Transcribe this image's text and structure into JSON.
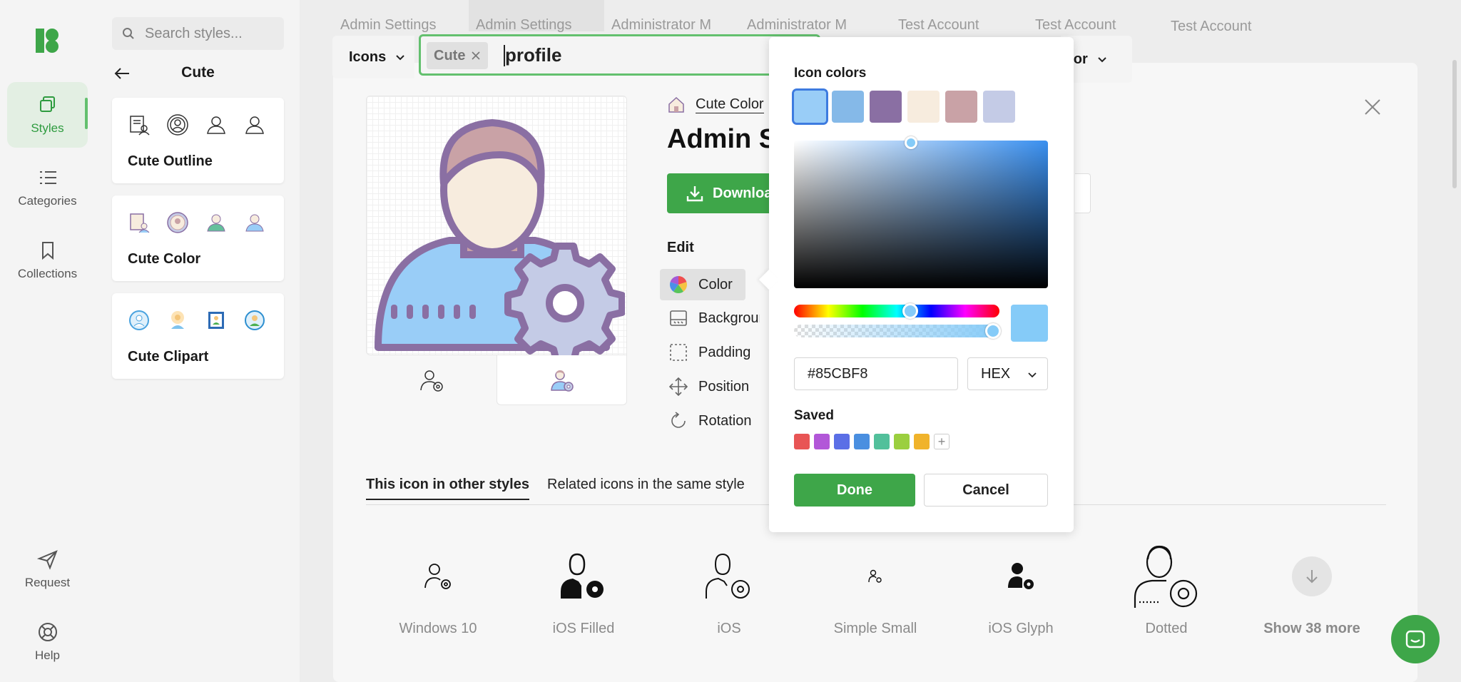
{
  "rail": {
    "items": [
      {
        "label": "Styles",
        "icon": "styles-icon"
      },
      {
        "label": "Categories",
        "icon": "list-icon"
      },
      {
        "label": "Collections",
        "icon": "bookmark-icon"
      },
      {
        "label": "Request",
        "icon": "send-icon"
      },
      {
        "label": "Help",
        "icon": "lifebuoy-icon"
      }
    ]
  },
  "styles_panel": {
    "search_placeholder": "Search styles...",
    "title": "Cute",
    "cards": [
      {
        "name": "Cute Outline"
      },
      {
        "name": "Cute Color"
      },
      {
        "name": "Cute Clipart"
      }
    ]
  },
  "top_tabs": [
    "Admin Settings",
    "Admin Settings",
    "Administrator M",
    "Administrator M",
    "Test Account",
    "Test Account",
    "Test Account"
  ],
  "toolbar": {
    "type_dropdown": "Icons",
    "chip": "Cute",
    "query": "profile",
    "color_dropdown": "olor"
  },
  "detail": {
    "style_name": "Cute Color",
    "title": "Admin Settings Male",
    "download_label": "Download",
    "edit_label": "Edit",
    "edit_items": [
      "Color",
      "Background",
      "Padding",
      "Position",
      "Rotation"
    ],
    "subtabs": [
      "This icon in other styles",
      "Related icons in the same style"
    ],
    "other_styles": [
      "Windows 10",
      "iOS Filled",
      "iOS",
      "Simple Small",
      "iOS Glyph",
      "Dotted",
      "Show 38 more"
    ]
  },
  "color_popover": {
    "title": "Icon colors",
    "swatches": [
      "#99cdf7",
      "#85b9e8",
      "#8a6fa3",
      "#f7ecde",
      "#c9a2a6",
      "#c4cbe6"
    ],
    "hex_value": "#85CBF8",
    "format": "HEX",
    "saved_label": "Saved",
    "saved": [
      "#e85555",
      "#b257d8",
      "#5b6fe6",
      "#4a8fe0",
      "#52c09b",
      "#9bcf3f",
      "#f0b32b"
    ],
    "done_label": "Done",
    "cancel_label": "Cancel"
  },
  "colors": {
    "accent": "#3ea649",
    "selected_color": "#85CBF8"
  }
}
